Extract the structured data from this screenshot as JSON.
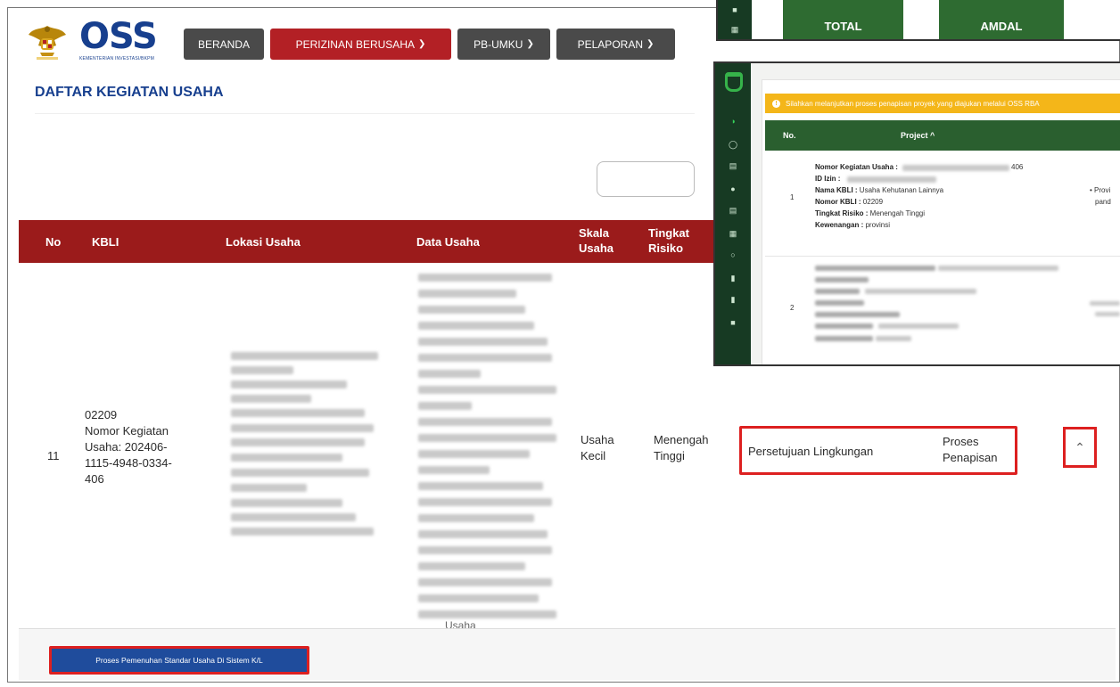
{
  "brand": {
    "logo_text": "OSS",
    "logo_subtitle": "KEMENTERIAN INVESTASI/BKPM"
  },
  "nav": {
    "items": [
      {
        "label": "BERANDA",
        "has_dropdown": false
      },
      {
        "label": "PERIZINAN BERUSAHA",
        "has_dropdown": true
      },
      {
        "label": "PB-UMKU",
        "has_dropdown": true
      },
      {
        "label": "PELAPORAN",
        "has_dropdown": true
      }
    ],
    "dropdown_icon": "chevron-down-icon"
  },
  "page": {
    "title": "DAFTAR KEGIATAN USAHA"
  },
  "table": {
    "headers": [
      "No",
      "KBLI",
      "Lokasi Usaha",
      "Data Usaha",
      "Skala Usaha",
      "Tingkat Risiko"
    ],
    "row": {
      "no": "11",
      "kbli_code": "02209",
      "kbli_label": "Nomor Kegiatan Usaha: 202406-1115-4948-0334-406",
      "skala_usaha": "Usaha Kecil",
      "tingkat_risiko": "Menengah Tinggi",
      "persetujuan": "Persetujuan Lingkungan",
      "status": "Proses Penapisan",
      "data_usaha_tail": "Usaha"
    },
    "expand_icon": "chevron-up-icon",
    "footer_button": "Proses Pemenuhan Standar Usaha Di Sistem K/L"
  },
  "overlay_top": {
    "tiles": [
      "TOTAL",
      "AMDAL"
    ]
  },
  "overlay_project": {
    "alert_text": "Silahkan melanjutkan proses penapisan proyek yang diajukan melalui OSS RBA",
    "headers": [
      "No.",
      "Project ^"
    ],
    "row1": {
      "no": "1",
      "nomor_kegiatan_label": "Nomor Kegiatan Usaha :",
      "nomor_kegiatan_value": "406",
      "id_izin_label": "ID Izin :",
      "nama_kbli_label": "Nama KBLI :",
      "nama_kbli_value": "Usaha Kehutanan Lainnya",
      "nomor_kbli_label": "Nomor KBLI :",
      "nomor_kbli_value": "02209",
      "tingkat_risiko_label": "Tingkat Risiko :",
      "tingkat_risiko_value": "Menengah Tinggi",
      "kewenangan_label": "Kewenangan :",
      "kewenangan_value": "provinsi",
      "side_text_1": "• Provi",
      "side_text_2": "pand"
    },
    "row2": {
      "no": "2"
    }
  },
  "colors": {
    "nav_red": "#b32025",
    "table_header": "#9b1b1b",
    "highlight": "#dd2020",
    "oss_blue": "#173f8e",
    "sidebar_green": "#173a23",
    "tile_green": "#2e6b31",
    "alert_yellow": "#f4b619"
  }
}
